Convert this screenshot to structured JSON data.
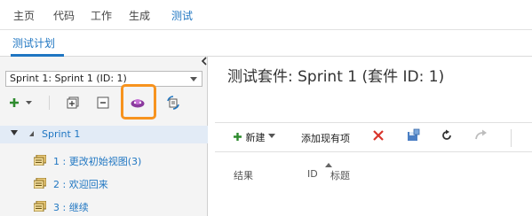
{
  "top_nav": {
    "items": [
      "主页",
      "代码",
      "工作",
      "生成",
      "测试"
    ],
    "active": "测试"
  },
  "sub_nav": {
    "tab": "测试计划"
  },
  "left_pane": {
    "plan_select": {
      "value": "Sprint 1: Sprint 1 (ID: 1)"
    },
    "tree": {
      "root": "Sprint 1",
      "suites": [
        "1 : 更改初始视图(3)",
        "2 : 欢迎回来",
        "3 : 继续"
      ]
    }
  },
  "right_pane": {
    "title": "测试套件: Sprint 1 (套件 ID: 1)",
    "toolbar": {
      "new_label": "新建",
      "add_existing_label": "添加现有项"
    },
    "columns": [
      "结果",
      "ID",
      "标题"
    ]
  },
  "colors": {
    "accent": "#1f76c2",
    "highlight": "#f7931e",
    "add_green": "#2e8b2e",
    "delete_red": "#d9342b"
  },
  "icons": [
    "plus-icon",
    "chevron-down-icon",
    "add-folder-icon",
    "collapse-icon",
    "team-icon",
    "refresh-suite-icon",
    "delete-x-icon",
    "save-icon",
    "refresh-icon",
    "redo-icon",
    "suite-icon"
  ]
}
